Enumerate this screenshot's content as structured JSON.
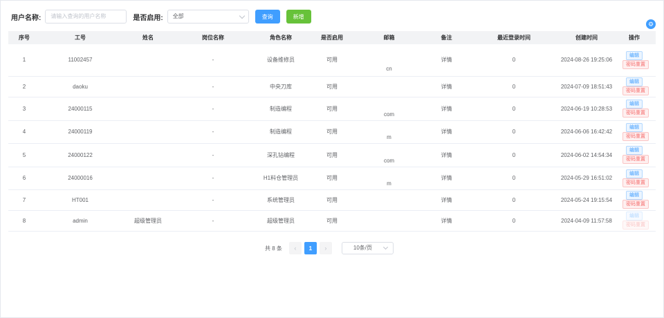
{
  "filter": {
    "username_label": "用户名称:",
    "username_placeholder": "请输入查询的用户名称",
    "enabled_label": "是否启用:",
    "enabled_value": "全部",
    "search_label": "查询",
    "add_label": "新增"
  },
  "settings_icon": "settings-icon",
  "table": {
    "headers": [
      "序号",
      "工号",
      "姓名",
      "岗位名称",
      "角色名称",
      "是否启用",
      "邮箱",
      "备注",
      "最近登录时间",
      "创建时间",
      "操作"
    ],
    "rows": [
      {
        "index": "1",
        "job_no": "11002457",
        "name": "",
        "post": "-",
        "role": "设备维修员",
        "enabled": "可用",
        "email": "cn",
        "note": "详情",
        "last_login": "0",
        "created": "2024-08-26 19:25:06",
        "edit": "编辑",
        "reset": "密码重置"
      },
      {
        "index": "2",
        "job_no": "daoku",
        "name": "",
        "post": "-",
        "role": "中央刀库",
        "enabled": "可用",
        "email": "",
        "note": "详情",
        "last_login": "0",
        "created": "2024-07-09 18:51:43",
        "edit": "编辑",
        "reset": "密码重置"
      },
      {
        "index": "3",
        "job_no": "24000115",
        "name": "",
        "post": "-",
        "role": "制造编程",
        "enabled": "可用",
        "email": "com",
        "note": "详情",
        "last_login": "0",
        "created": "2024-06-19 10:28:53",
        "edit": "编辑",
        "reset": "密码重置"
      },
      {
        "index": "4",
        "job_no": "24000119",
        "name": "",
        "post": "-",
        "role": "制造编程",
        "enabled": "可用",
        "email": "m",
        "note": "详情",
        "last_login": "0",
        "created": "2024-06-06 16:42:42",
        "edit": "编辑",
        "reset": "密码重置"
      },
      {
        "index": "5",
        "job_no": "24000122",
        "name": "",
        "post": "-",
        "role": "深孔钻编程",
        "enabled": "可用",
        "email": "com",
        "note": "详情",
        "last_login": "0",
        "created": "2024-06-02 14:54:34",
        "edit": "编辑",
        "reset": "密码重置"
      },
      {
        "index": "6",
        "job_no": "24000016",
        "name": "",
        "post": "-",
        "role": "H1料仓管理员",
        "enabled": "可用",
        "email": "m",
        "note": "详情",
        "last_login": "0",
        "created": "2024-05-29 16:51:02",
        "edit": "编辑",
        "reset": "密码重置"
      },
      {
        "index": "7",
        "job_no": "HT001",
        "name": "",
        "post": "-",
        "role": "系统管理员",
        "enabled": "可用",
        "email": "",
        "note": "详情",
        "last_login": "0",
        "created": "2024-05-24 19:15:54",
        "edit": "编辑",
        "reset": "密码重置"
      },
      {
        "index": "8",
        "job_no": "admin",
        "name": "超级管理员",
        "post": "-",
        "role": "超级管理员",
        "enabled": "可用",
        "email": "",
        "note": "详情",
        "last_login": "0",
        "created": "2024-04-09 11:57:58",
        "edit": "编辑",
        "reset": "密码重置",
        "actions_disabled": true
      }
    ]
  },
  "pagination": {
    "total": "共 8 条",
    "prev": "‹",
    "current": "1",
    "next": "›",
    "page_size": "10条/页"
  },
  "colors": {
    "primary": "#409eff",
    "success": "#67c23a",
    "danger": "#f56c6c"
  }
}
